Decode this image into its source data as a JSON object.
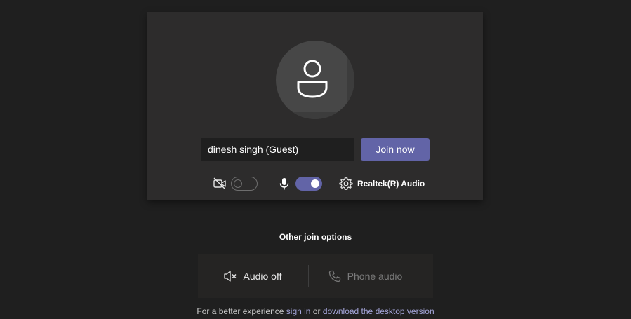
{
  "prejoin": {
    "name_value": "dinesh singh (Guest)",
    "join_label": "Join now",
    "camera_on": false,
    "mic_on": true,
    "audio_device_label": "Realtek(R) Audio"
  },
  "other_options": {
    "title": "Other join options",
    "audio_off_label": "Audio off",
    "phone_audio_label": "Phone audio"
  },
  "footer": {
    "prefix": "For a better experience",
    "sign_in_link": "sign in",
    "middle": "or",
    "download_link": "download the desktop version"
  },
  "colors": {
    "accent": "#6264a7",
    "background": "#1f1f1f",
    "card": "#2d2c2c",
    "link": "#a6a7dc"
  },
  "icons": {
    "avatar": "person-icon",
    "camera": "camera-off-icon",
    "mic": "microphone-icon",
    "settings": "gear-icon",
    "speaker": "speaker-off-icon",
    "phone": "phone-icon"
  }
}
